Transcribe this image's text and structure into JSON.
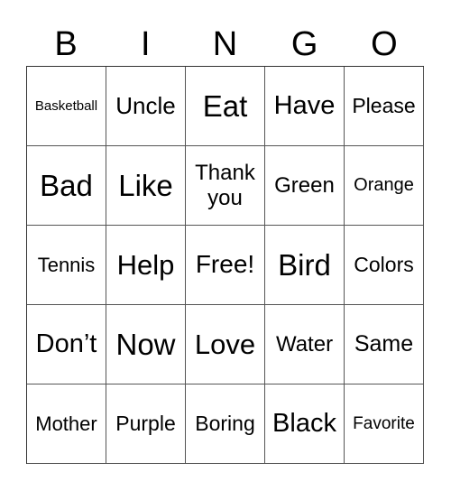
{
  "header": [
    "B",
    "I",
    "N",
    "G",
    "O"
  ],
  "cells": [
    [
      {
        "t": "Basketball",
        "s": 15
      },
      {
        "t": "Uncle",
        "s": 26
      },
      {
        "t": "Eat",
        "s": 33
      },
      {
        "t": "Have",
        "s": 29
      },
      {
        "t": "Please",
        "s": 23
      }
    ],
    [
      {
        "t": "Bad",
        "s": 33
      },
      {
        "t": "Like",
        "s": 33
      },
      {
        "t": "Thank you",
        "s": 24
      },
      {
        "t": "Green",
        "s": 24
      },
      {
        "t": "Orange",
        "s": 20
      }
    ],
    [
      {
        "t": "Tennis",
        "s": 22
      },
      {
        "t": "Help",
        "s": 31
      },
      {
        "t": "Free!",
        "s": 28
      },
      {
        "t": "Bird",
        "s": 33
      },
      {
        "t": "Colors",
        "s": 23
      }
    ],
    [
      {
        "t": "Don’t",
        "s": 29
      },
      {
        "t": "Now",
        "s": 33
      },
      {
        "t": "Love",
        "s": 31
      },
      {
        "t": "Water",
        "s": 24
      },
      {
        "t": "Same",
        "s": 25
      }
    ],
    [
      {
        "t": "Mother",
        "s": 22
      },
      {
        "t": "Purple",
        "s": 23
      },
      {
        "t": "Boring",
        "s": 23
      },
      {
        "t": "Black",
        "s": 29
      },
      {
        "t": "Favorite",
        "s": 19
      }
    ]
  ]
}
